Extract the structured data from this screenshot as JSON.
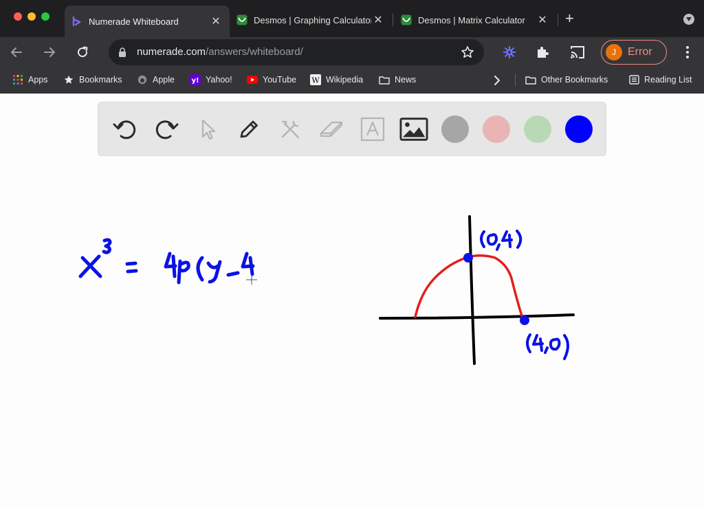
{
  "tabs": [
    {
      "title": "Numerade Whiteboard",
      "active": true,
      "icon": "numerade-logo-icon"
    },
    {
      "title": "Desmos | Graphing Calculator",
      "active": false,
      "icon": "desmos-logo-icon"
    },
    {
      "title": "Desmos | Matrix Calculator",
      "active": false,
      "icon": "desmos-logo-icon"
    }
  ],
  "address_bar": {
    "url_host": "numerade.com",
    "url_path": "/answers/whiteboard/"
  },
  "profile": {
    "initial": "J",
    "status": "Error"
  },
  "bookmarks": [
    {
      "label": "Apps",
      "icon": "apps-grid-icon"
    },
    {
      "label": "Bookmarks",
      "icon": "star-icon"
    },
    {
      "label": "Apple",
      "icon": "apple-icon"
    },
    {
      "label": "Yahoo!",
      "icon": "yahoo-icon"
    },
    {
      "label": "YouTube",
      "icon": "youtube-icon"
    },
    {
      "label": "Wikipedia",
      "icon": "wikipedia-icon"
    },
    {
      "label": "News",
      "icon": "folder-icon"
    }
  ],
  "bookmarks_right": [
    {
      "label": "Other Bookmarks",
      "icon": "folder-icon"
    },
    {
      "label": "Reading List",
      "icon": "reading-list-icon"
    }
  ],
  "whiteboard": {
    "tools": [
      "undo-icon",
      "redo-icon",
      "select-pointer-icon",
      "pen-icon",
      "tools-icon",
      "eraser-icon",
      "text-icon",
      "image-icon"
    ],
    "colors": [
      "#a6a6a6",
      "#eab4b4",
      "#b9d8b5",
      "#0000ff"
    ],
    "selected_color": "#0000ff"
  },
  "handwriting": {
    "equation": "x³ = 4p(y−4",
    "point_top": "(0,4)",
    "point_right": "(4,0)",
    "ink_colors": {
      "blue": "#0b12e6",
      "red": "#e61c1c",
      "black": "#000000"
    }
  }
}
